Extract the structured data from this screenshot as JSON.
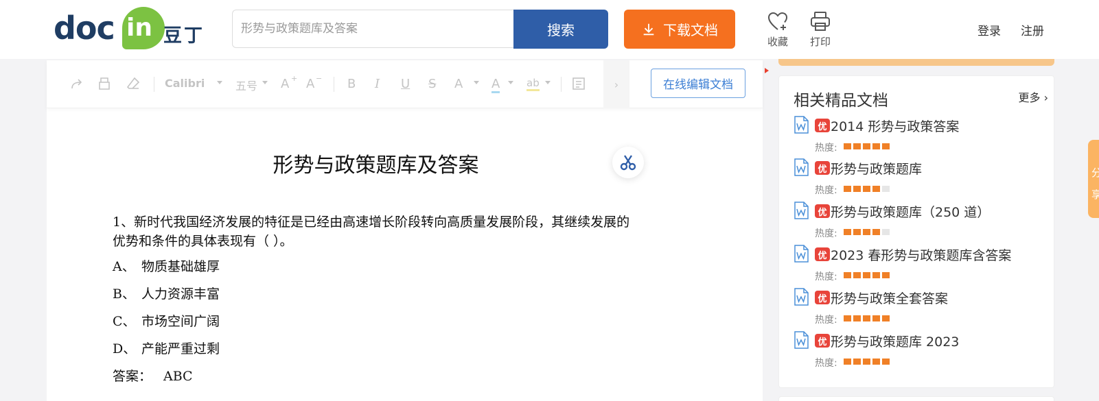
{
  "header": {
    "logo_text": "doc",
    "logo_in": "in",
    "logo_cn": "豆丁",
    "search_placeholder": "形势与政策题库及答案",
    "search_button": "搜索",
    "download_button": "下载文档",
    "favorite_label": "收藏",
    "print_label": "打印",
    "login": "登录",
    "register": "注册"
  },
  "toolbar": {
    "font_name": "Calibri",
    "font_size": "五号",
    "grow_font": "A",
    "shrink_font": "A",
    "bold": "B",
    "italic": "I",
    "underline": "U",
    "strike": "S",
    "superscript": "A",
    "font_color": "A",
    "highlight": "ab",
    "edit_online": "在线编辑文档"
  },
  "document": {
    "title": "形势与政策题库及答案",
    "question_line1": "1、新时代我国经济发展的特征是已经由高速增长阶段转向高质量发展阶段，其继续发展的",
    "question_line2": "优势和条件的具体表现有（    ）。",
    "options": [
      {
        "letter": "A、",
        "text": "物质基础雄厚"
      },
      {
        "letter": "B、",
        "text": "人力资源丰富"
      },
      {
        "letter": "C、",
        "text": "市场空间广阔"
      },
      {
        "letter": "D、",
        "text": "产能严重过剩"
      }
    ],
    "answer_label": "答案：",
    "answer_value": "ABC"
  },
  "sidebar": {
    "title": "相关精品文档",
    "more": "更多",
    "heat_label": "热度:",
    "badge": "优",
    "items": [
      {
        "title": "2014 形势与政策答案",
        "heat": 5
      },
      {
        "title": "形势与政策题库",
        "heat": 4
      },
      {
        "title": "形势与政策题库（250 道）",
        "heat": 4
      },
      {
        "title": "2023 春形势与政策题库含答案",
        "heat": 5
      },
      {
        "title": "形势与政策全套答案",
        "heat": 5
      },
      {
        "title": "形势与政策题库 2023",
        "heat": 5
      }
    ]
  },
  "share_tab": {
    "label_1": "分",
    "label_2": "享"
  },
  "colors": {
    "brand_blue": "#2f5ea8",
    "download_orange": "#f5701f",
    "logo_green": "#7cc242",
    "badge_red": "#e8443a",
    "heat_orange": "#f08027"
  }
}
